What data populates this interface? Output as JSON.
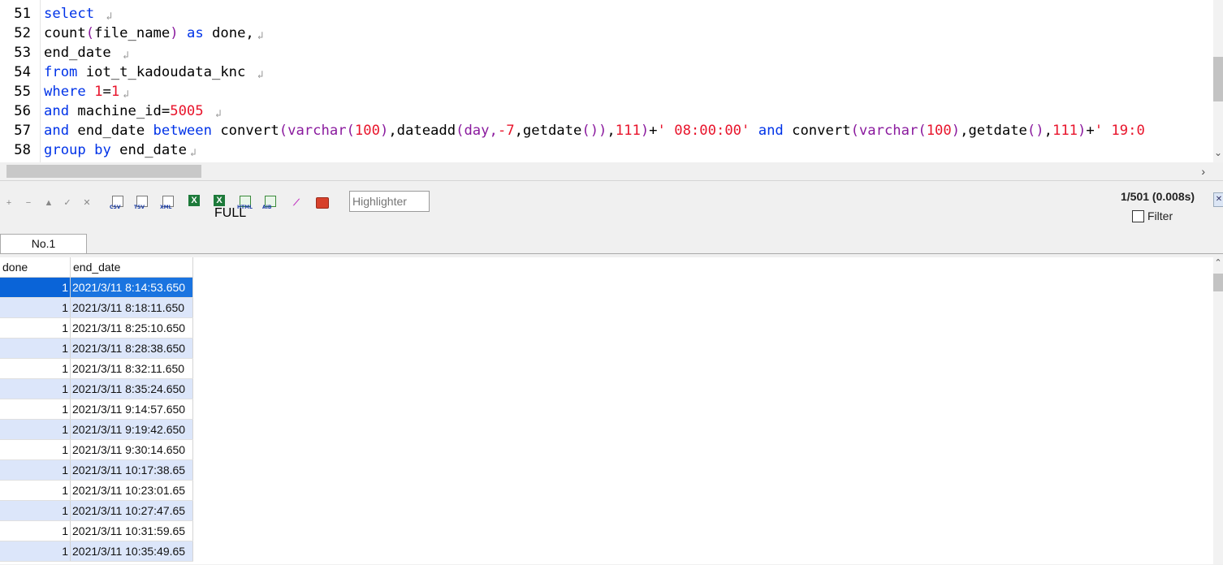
{
  "editor": {
    "lines": [
      {
        "num": "51",
        "tokens": [
          {
            "t": "select",
            "c": "kw"
          },
          {
            "t": " ",
            "c": "plain"
          }
        ]
      },
      {
        "num": "52",
        "tokens": [
          {
            "t": "count",
            "c": "plain"
          },
          {
            "t": "(",
            "c": "fn"
          },
          {
            "t": "file_name",
            "c": "plain"
          },
          {
            "t": ")",
            "c": "fn"
          },
          {
            "t": " ",
            "c": "plain"
          },
          {
            "t": "as",
            "c": "kw"
          },
          {
            "t": " done,",
            "c": "plain"
          }
        ]
      },
      {
        "num": "53",
        "tokens": [
          {
            "t": "end_date ",
            "c": "plain"
          }
        ]
      },
      {
        "num": "54",
        "tokens": [
          {
            "t": "from",
            "c": "kw"
          },
          {
            "t": " iot_t_kadoudata_knc ",
            "c": "plain"
          }
        ]
      },
      {
        "num": "55",
        "tokens": [
          {
            "t": "where",
            "c": "kw"
          },
          {
            "t": " ",
            "c": "plain"
          },
          {
            "t": "1",
            "c": "num"
          },
          {
            "t": "=",
            "c": "plain"
          },
          {
            "t": "1",
            "c": "num"
          }
        ]
      },
      {
        "num": "56",
        "tokens": [
          {
            "t": "and",
            "c": "kw"
          },
          {
            "t": " machine_id=",
            "c": "plain"
          },
          {
            "t": "5005",
            "c": "num"
          },
          {
            "t": " ",
            "c": "plain"
          }
        ]
      },
      {
        "num": "57",
        "tokens": [
          {
            "t": "and",
            "c": "kw"
          },
          {
            "t": " end_date ",
            "c": "plain"
          },
          {
            "t": "between",
            "c": "kw"
          },
          {
            "t": " convert",
            "c": "plain"
          },
          {
            "t": "(varchar(",
            "c": "fn"
          },
          {
            "t": "100",
            "c": "num"
          },
          {
            "t": ")",
            "c": "fn"
          },
          {
            "t": ",dateadd",
            "c": "plain"
          },
          {
            "t": "(day,",
            "c": "fn"
          },
          {
            "t": "-7",
            "c": "num"
          },
          {
            "t": ",getdate",
            "c": "plain"
          },
          {
            "t": "())",
            "c": "fn"
          },
          {
            "t": ",",
            "c": "plain"
          },
          {
            "t": "111",
            "c": "num"
          },
          {
            "t": ")",
            "c": "fn"
          },
          {
            "t": "+",
            "c": "plain"
          },
          {
            "t": "' 08:00:00'",
            "c": "str"
          },
          {
            "t": " ",
            "c": "plain"
          },
          {
            "t": "and",
            "c": "kw"
          },
          {
            "t": " convert",
            "c": "plain"
          },
          {
            "t": "(varchar(",
            "c": "fn"
          },
          {
            "t": "100",
            "c": "num"
          },
          {
            "t": ")",
            "c": "fn"
          },
          {
            "t": ",getdate",
            "c": "plain"
          },
          {
            "t": "()",
            "c": "fn"
          },
          {
            "t": ",",
            "c": "plain"
          },
          {
            "t": "111",
            "c": "num"
          },
          {
            "t": ")",
            "c": "fn"
          },
          {
            "t": "+",
            "c": "plain"
          },
          {
            "t": "' 19:0",
            "c": "str"
          }
        ]
      },
      {
        "num": "58",
        "tokens": [
          {
            "t": "group",
            "c": "kw"
          },
          {
            "t": " ",
            "c": "plain"
          },
          {
            "t": "by",
            "c": "kw"
          },
          {
            "t": " end_date",
            "c": "plain"
          }
        ]
      }
    ],
    "eol_marker": "↲",
    "eol_lines": [
      "51",
      "52",
      "53",
      "54",
      "55",
      "56",
      "58"
    ]
  },
  "toolbar": {
    "icons": [
      "plus-icon",
      "minus-icon",
      "up-icon",
      "check-icon",
      "cancel-icon"
    ],
    "icon_glyphs": [
      "+",
      "−",
      "▲",
      "✓",
      "✕"
    ],
    "export_formats": [
      "CSV",
      "TSV",
      "XML"
    ],
    "excel_icons": [
      "X",
      "X"
    ],
    "excel_tags": [
      "",
      "FULL"
    ],
    "other_formats": [
      "HTML",
      "AIB"
    ],
    "highlighter_placeholder": "Highlighter",
    "row_count": "1/501 (0.008s)",
    "filter_label": "Filter"
  },
  "tabs": [
    {
      "label": "No.1"
    }
  ],
  "grid": {
    "columns": [
      "done",
      "end_date"
    ],
    "rows": [
      {
        "done": "1",
        "end_date": "2021/3/11 8:14:53.650"
      },
      {
        "done": "1",
        "end_date": "2021/3/11 8:18:11.650"
      },
      {
        "done": "1",
        "end_date": "2021/3/11 8:25:10.650"
      },
      {
        "done": "1",
        "end_date": "2021/3/11 8:28:38.650"
      },
      {
        "done": "1",
        "end_date": "2021/3/11 8:32:11.650"
      },
      {
        "done": "1",
        "end_date": "2021/3/11 8:35:24.650"
      },
      {
        "done": "1",
        "end_date": "2021/3/11 9:14:57.650"
      },
      {
        "done": "1",
        "end_date": "2021/3/11 9:19:42.650"
      },
      {
        "done": "1",
        "end_date": "2021/3/11 9:30:14.650"
      },
      {
        "done": "1",
        "end_date": "2021/3/11 10:17:38.65"
      },
      {
        "done": "1",
        "end_date": "2021/3/11 10:23:01.65"
      },
      {
        "done": "1",
        "end_date": "2021/3/11 10:27:47.65"
      },
      {
        "done": "1",
        "end_date": "2021/3/11 10:31:59.65"
      },
      {
        "done": "1",
        "end_date": "2021/3/11 10:35:49.65"
      }
    ],
    "selected_row": 0
  },
  "colors": {
    "keyword": "#0033e8",
    "number": "#e8142b",
    "function": "#8a1a9e",
    "selection": "#0a64d8",
    "alt_row": "#dce6fa"
  }
}
